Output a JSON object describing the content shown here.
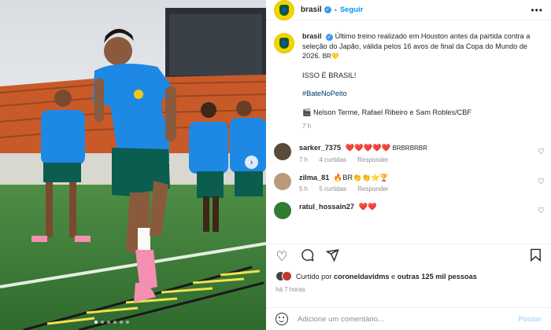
{
  "header": {
    "username": "brasil",
    "follow": "Seguir",
    "more": "•••"
  },
  "caption": {
    "username": "brasil",
    "text": "Último treino realizado em Houston antes da partida contra a seleção do Japão, válida pelos 16 avos de final da Copa do Mundo de 2026.",
    "flag": "BR💛",
    "line2": "ISSO É BRASIL!",
    "hashtag": "#BateNoPeito",
    "credit": "🎬 Nelson Terme, Rafael Ribeiro e Sam Robles/CBF",
    "time": "7 h"
  },
  "comments": [
    {
      "username": "sarker_7375",
      "text": "❤️❤️❤️❤️❤️",
      "tail": "BRBRBRBR",
      "time": "7 h",
      "likes": "4 curtidas",
      "reply": "Responder",
      "avatar_color": "#5a4a3a"
    },
    {
      "username": "zilma_81",
      "text": "🔥BR👏👏⭐🏆",
      "tail": "",
      "time": "5 h",
      "likes": "5 curtidas",
      "reply": "Responder",
      "avatar_color": "#b89a7a"
    },
    {
      "username": "ratul_hossain27",
      "text": "❤️❤️",
      "tail": "",
      "time": "",
      "likes": "",
      "reply": "",
      "avatar_color": "#2e7d32"
    }
  ],
  "actions": {
    "liked_by_prefix": "Curtido por",
    "liked_by_user": "coroneldavidms",
    "liked_by_and": "e",
    "liked_by_others": "outras 125 mil pessoas",
    "posted_ago": "há 7 horas"
  },
  "add_comment": {
    "placeholder": "Adicione um comentário...",
    "post": "Postar"
  },
  "colors": {
    "accent": "#0095f6",
    "jersey": "#1e88e5",
    "shorts": "#0b5d4f",
    "grass": "#3e7a3a"
  }
}
